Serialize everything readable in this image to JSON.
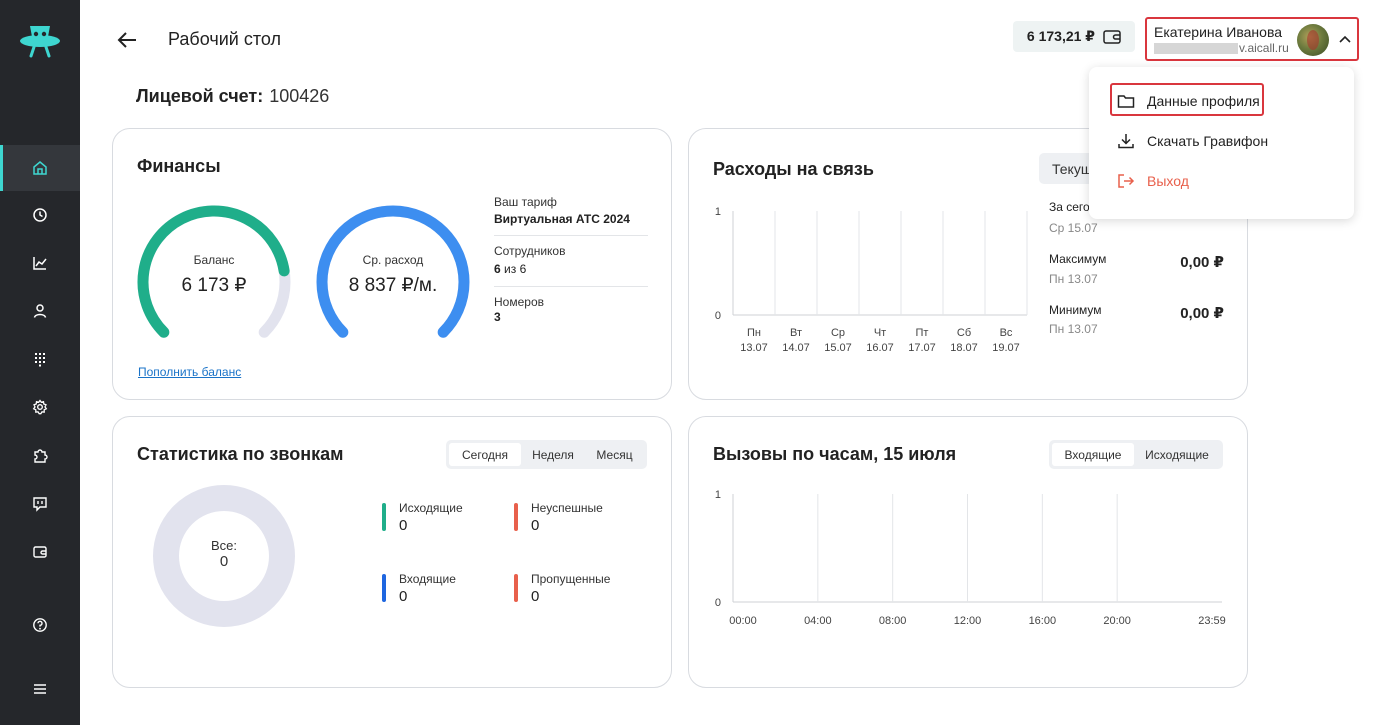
{
  "header": {
    "title": "Рабочий стол",
    "balance": "6 173,21 ₽",
    "user_name": "Екатерина Иванова",
    "user_email_suffix": "v.aicall.ru"
  },
  "account": {
    "label": "Лицевой счет:",
    "number": "100426"
  },
  "sidebar": {
    "items": [
      {
        "icon": "home-icon",
        "active": true
      },
      {
        "icon": "history-icon",
        "active": false
      },
      {
        "icon": "chart-icon",
        "active": false
      },
      {
        "icon": "user-icon",
        "active": false
      },
      {
        "icon": "dialpad-icon",
        "active": false
      },
      {
        "icon": "gear-icon",
        "active": false
      },
      {
        "icon": "puzzle-icon",
        "active": false
      },
      {
        "icon": "chat-icon",
        "active": false
      },
      {
        "icon": "wallet-icon",
        "active": false
      },
      {
        "icon": "help-icon",
        "active": false
      },
      {
        "icon": "menu-icon",
        "active": false
      }
    ]
  },
  "finance": {
    "title": "Финансы",
    "balance_label": "Баланс",
    "balance_value": "6 173 ₽",
    "balance_fraction": 0.8,
    "avg_label": "Ср. расход",
    "avg_value": "8 837 ₽/м.",
    "avg_fraction": 1.0,
    "tariff_label": "Ваш тариф",
    "tariff_value": "Виртуальная АТС 2024",
    "employees_label": "Сотрудников",
    "employees_used": "6",
    "employees_sep": "из",
    "employees_total": "6",
    "numbers_label": "Номеров",
    "numbers_value": "3",
    "topup_link": "Пополнить баланс"
  },
  "expenses": {
    "title": "Расходы на связь",
    "period_button": "Текущая неделя",
    "stats": [
      {
        "label": "За сегодня",
        "sub": "Ср 15.07",
        "value": ""
      },
      {
        "label": "Максимум",
        "sub": "Пн 13.07",
        "value": "0,00 ₽"
      },
      {
        "label": "Минимум",
        "sub": "Пн 13.07",
        "value": "0,00 ₽"
      }
    ]
  },
  "calls_stats": {
    "title": "Статистика по звонкам",
    "tabs": [
      "Сегодня",
      "Неделя",
      "Месяц"
    ],
    "selected_tab": 0,
    "total_label": "Все:",
    "total_value": "0",
    "legend": [
      {
        "label": "Исходящие",
        "value": "0",
        "color": "#1fae8a"
      },
      {
        "label": "Неуспешные",
        "value": "0",
        "color": "#e8604c"
      },
      {
        "label": "Входящие",
        "value": "0",
        "color": "#1e66e0"
      },
      {
        "label": "Пропущенные",
        "value": "0",
        "color": "#e8604c"
      }
    ]
  },
  "hourly": {
    "title": "Вызовы по часам, 15 июля",
    "tabs": [
      "Входящие",
      "Исходящие"
    ],
    "selected_tab": 0
  },
  "dropdown": {
    "items": [
      {
        "label": "Данные профиля",
        "icon": "folder-icon"
      },
      {
        "label": "Скачать Гравифон",
        "icon": "download-icon"
      },
      {
        "label": "Выход",
        "icon": "logout-icon"
      }
    ]
  },
  "colors": {
    "accent": "#3ed6d0",
    "balance_gauge": "#1fae8a",
    "avg_gauge": "#3d8ef0",
    "gauge_track": "#e2e3ee",
    "highlight": "#d9363e"
  },
  "chart_data": [
    {
      "type": "bar",
      "title": "Расходы на связь",
      "categories": [
        "Пн 13.07",
        "Вт 14.07",
        "Ср 15.07",
        "Чт 16.07",
        "Пт 17.07",
        "Сб 18.07",
        "Вс 19.07"
      ],
      "cat_day": [
        "Пн",
        "Вт",
        "Ср",
        "Чт",
        "Пт",
        "Сб",
        "Вс"
      ],
      "cat_date": [
        "13.07",
        "14.07",
        "15.07",
        "16.07",
        "17.07",
        "18.07",
        "19.07"
      ],
      "values": [
        0,
        0,
        0,
        0,
        0,
        0,
        0
      ],
      "yticks": [
        "1",
        "0"
      ],
      "ylim": [
        0,
        1
      ],
      "grid": true
    },
    {
      "type": "bar",
      "title": "Вызовы по часам, 15 июля",
      "x_ticks": [
        "00:00",
        "04:00",
        "08:00",
        "12:00",
        "16:00",
        "20:00",
        "23:59"
      ],
      "values": [],
      "yticks": [
        "1",
        "0"
      ],
      "ylim": [
        0,
        1
      ],
      "grid": true
    }
  ]
}
